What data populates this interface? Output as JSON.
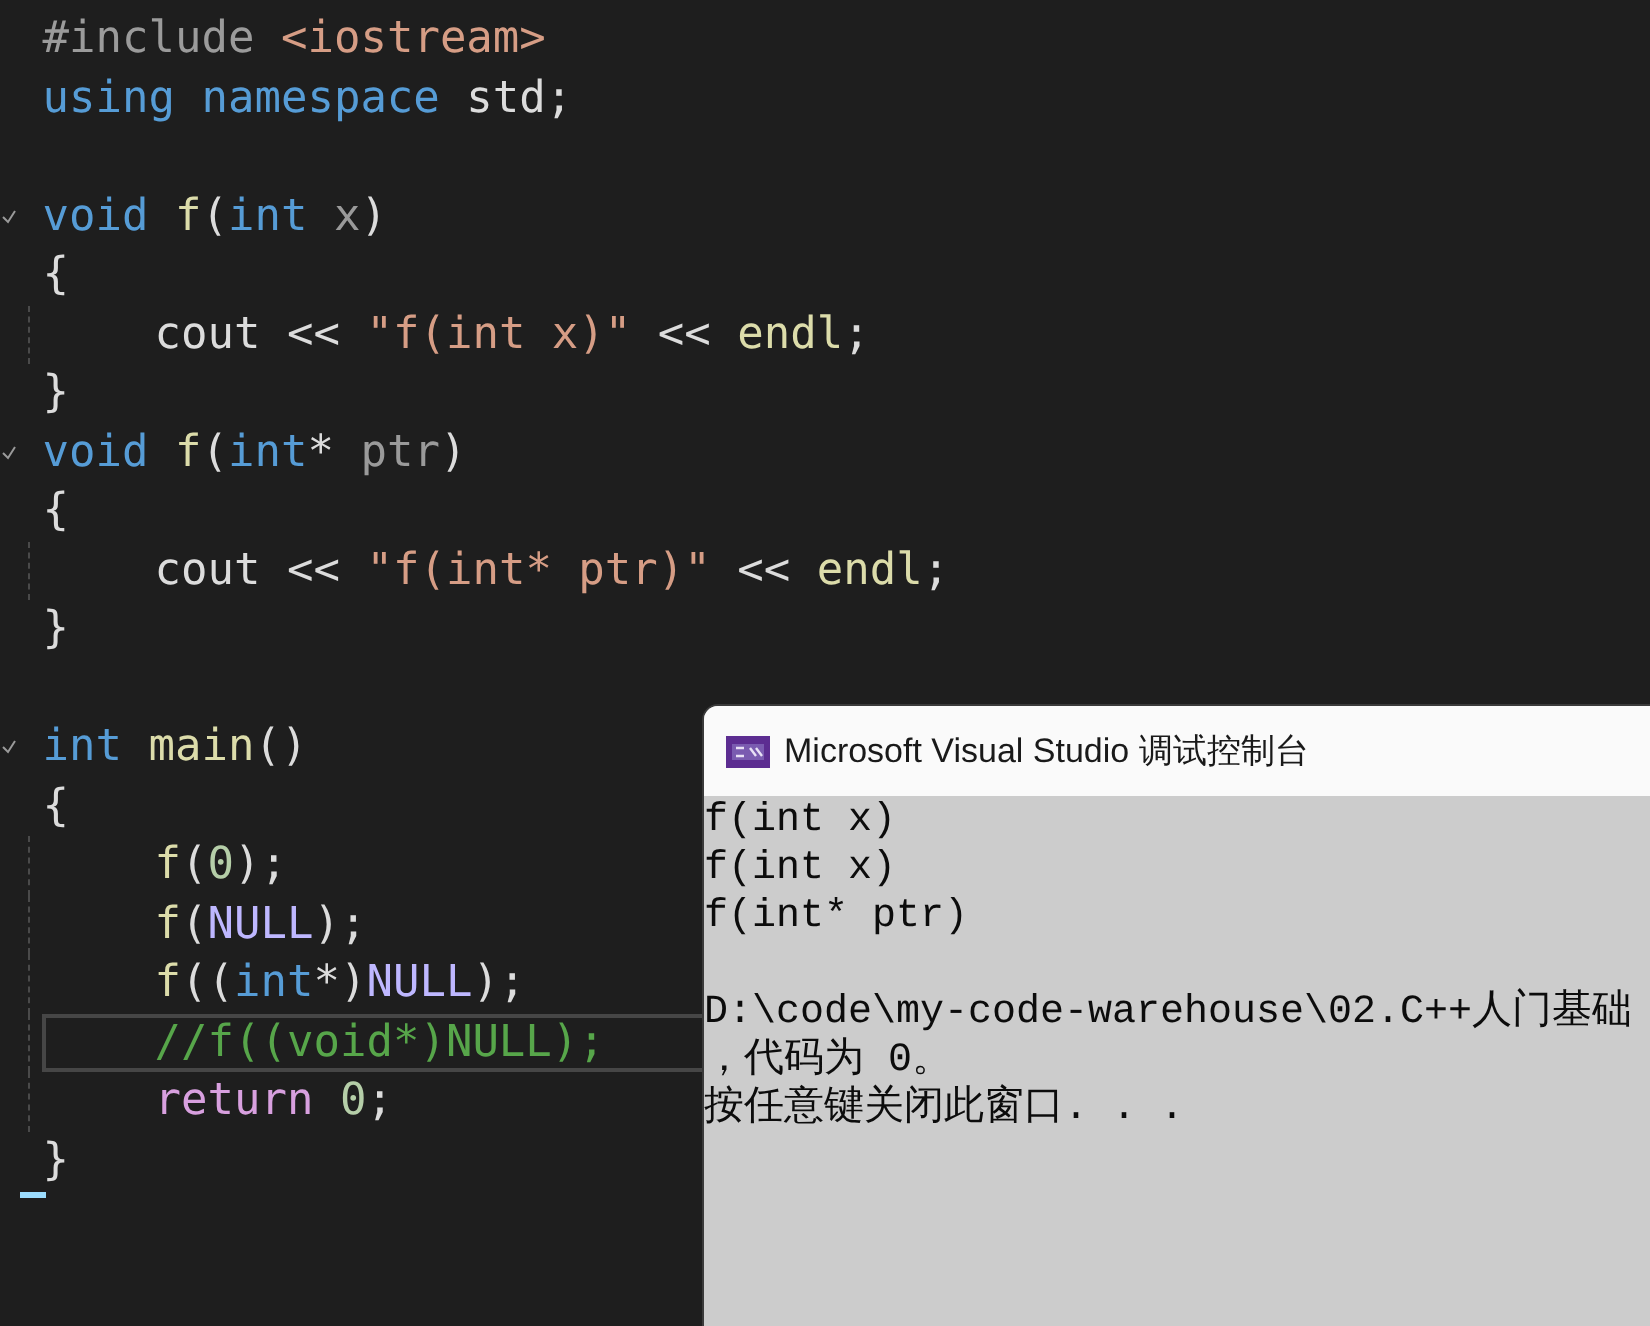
{
  "editor": {
    "lines": [
      {
        "kind": "top",
        "tokens": [
          {
            "text": "#include ",
            "kind": "preproc"
          },
          {
            "text": "<iostream>",
            "kind": "string"
          }
        ]
      },
      {
        "kind": "top",
        "tokens": [
          {
            "text": "using namespace ",
            "kind": "keyword"
          },
          {
            "text": "std",
            "kind": "plain"
          },
          {
            "text": ";",
            "kind": "plain"
          }
        ]
      },
      {
        "kind": "blank"
      },
      {
        "kind": "top",
        "fold": true,
        "tokens": [
          {
            "text": "void ",
            "kind": "keyword"
          },
          {
            "text": "f",
            "kind": "func"
          },
          {
            "text": "(",
            "kind": "plain"
          },
          {
            "text": "int ",
            "kind": "keyword"
          },
          {
            "text": "x",
            "kind": "param"
          },
          {
            "text": ")",
            "kind": "plain"
          }
        ]
      },
      {
        "kind": "top",
        "tokens": [
          {
            "text": "{",
            "kind": "plain"
          }
        ]
      },
      {
        "kind": "body",
        "tokens": [
          {
            "text": "cout",
            "kind": "plain"
          },
          {
            "text": " << ",
            "kind": "plain"
          },
          {
            "text": "\"f(int x)\"",
            "kind": "string"
          },
          {
            "text": " << ",
            "kind": "plain"
          },
          {
            "text": "endl",
            "kind": "func"
          },
          {
            "text": ";",
            "kind": "plain"
          }
        ]
      },
      {
        "kind": "top",
        "tokens": [
          {
            "text": "}",
            "kind": "plain"
          }
        ]
      },
      {
        "kind": "top",
        "fold": true,
        "tokens": [
          {
            "text": "void ",
            "kind": "keyword"
          },
          {
            "text": "f",
            "kind": "func"
          },
          {
            "text": "(",
            "kind": "plain"
          },
          {
            "text": "int",
            "kind": "keyword"
          },
          {
            "text": "* ",
            "kind": "plain"
          },
          {
            "text": "ptr",
            "kind": "param"
          },
          {
            "text": ")",
            "kind": "plain"
          }
        ]
      },
      {
        "kind": "top",
        "tokens": [
          {
            "text": "{",
            "kind": "plain"
          }
        ]
      },
      {
        "kind": "body",
        "tokens": [
          {
            "text": "cout",
            "kind": "plain"
          },
          {
            "text": " << ",
            "kind": "plain"
          },
          {
            "text": "\"f(int* ptr)\"",
            "kind": "string"
          },
          {
            "text": " << ",
            "kind": "plain"
          },
          {
            "text": "endl",
            "kind": "func"
          },
          {
            "text": ";",
            "kind": "plain"
          }
        ]
      },
      {
        "kind": "top",
        "tokens": [
          {
            "text": "}",
            "kind": "plain"
          }
        ]
      },
      {
        "kind": "blank"
      },
      {
        "kind": "top",
        "fold": true,
        "tokens": [
          {
            "text": "int ",
            "kind": "keyword"
          },
          {
            "text": "main",
            "kind": "func"
          },
          {
            "text": "()",
            "kind": "plain"
          }
        ]
      },
      {
        "kind": "top",
        "tokens": [
          {
            "text": "{",
            "kind": "plain"
          }
        ]
      },
      {
        "kind": "body",
        "tokens": [
          {
            "text": "f",
            "kind": "func"
          },
          {
            "text": "(",
            "kind": "plain"
          },
          {
            "text": "0",
            "kind": "number"
          },
          {
            "text": ");",
            "kind": "plain"
          }
        ]
      },
      {
        "kind": "body",
        "tokens": [
          {
            "text": "f",
            "kind": "func"
          },
          {
            "text": "(",
            "kind": "plain"
          },
          {
            "text": "NULL",
            "kind": "macro"
          },
          {
            "text": ");",
            "kind": "plain"
          }
        ]
      },
      {
        "kind": "body",
        "tokens": [
          {
            "text": "f",
            "kind": "func"
          },
          {
            "text": "((",
            "kind": "plain"
          },
          {
            "text": "int",
            "kind": "keyword"
          },
          {
            "text": "*)",
            "kind": "plain"
          },
          {
            "text": "NULL",
            "kind": "macro"
          },
          {
            "text": ");",
            "kind": "plain"
          }
        ]
      },
      {
        "kind": "body",
        "current": true,
        "tokens": [
          {
            "text": "//f((void*)NULL);",
            "kind": "comment"
          }
        ]
      },
      {
        "kind": "body",
        "tokens": [
          {
            "text": "return ",
            "kind": "control"
          },
          {
            "text": "0",
            "kind": "number"
          },
          {
            "text": ";",
            "kind": "plain"
          }
        ]
      },
      {
        "kind": "top",
        "cursor": true,
        "tokens": [
          {
            "text": "}",
            "kind": "plain"
          }
        ]
      }
    ]
  },
  "console": {
    "title": "Microsoft Visual Studio 调试控制台",
    "output": [
      {
        "kind": "text",
        "text": "f(int x)"
      },
      {
        "kind": "text",
        "text": "f(int x)"
      },
      {
        "kind": "text",
        "text": "f(int* ptr)"
      },
      {
        "kind": "blank"
      },
      {
        "kind": "text",
        "text": "D:\\code\\my-code-warehouse\\02.C++人门基础"
      },
      {
        "kind": "text",
        "text": "，代码为 0。"
      },
      {
        "kind": "text",
        "text": "按任意键关闭此窗口. . ."
      }
    ]
  }
}
